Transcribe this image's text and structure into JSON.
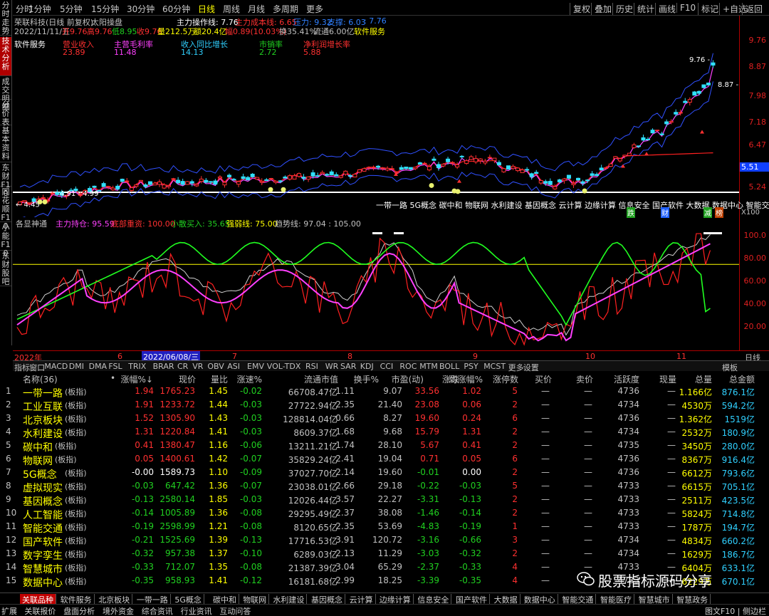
{
  "sidebar": [
    "分时走势",
    "技术分析",
    "成交明细",
    "分价表",
    "基本资料",
    "东财F10",
    "同花顺F10",
    "小能F10",
    "东财股吧"
  ],
  "toolbar": {
    "periods": [
      "分时",
      "1分钟",
      "5分钟",
      "15分钟",
      "30分钟",
      "60分钟",
      "日线",
      "周线",
      "月线",
      "多周期",
      "更多"
    ],
    "selected": "日线",
    "right": [
      "复权",
      "叠加",
      "历史",
      "统计",
      "画线",
      "F10",
      "标记",
      "+自选",
      "返回"
    ]
  },
  "header": {
    "stock": "荣联科技(日线 前复权)",
    "indicator": "太阳操盘",
    "zl_line": "主力操作线: 7.76",
    "zl_cost": "主力成本线: 6.65",
    "ya_li": "压力: 9.32",
    "zhi_cheng": "支撑: 6.03",
    "zhi_cheng2": ": 7.76"
  },
  "quote": {
    "date": "2022/11/11/五",
    "open": "开9.76",
    "high": "高9.76",
    "low": "低8.95",
    "close": "收9.76",
    "volume": "量212.5万",
    "amount": "额20.4亿",
    "change": "幅0.89(10.03%)",
    "turnover": "换35.41%",
    "float": "流通6.00亿",
    "industry": "软件服务"
  },
  "metrics": {
    "name": "软件服务",
    "items": [
      {
        "label": "营业收入",
        "value": "23.89",
        "lc": "#ff3030",
        "vc": "#ff3030"
      },
      {
        "label": "主营毛利率",
        "value": "11.48",
        "lc": "#ff40ff",
        "vc": "#ff40ff"
      },
      {
        "label": "收入同比增长",
        "value": "14.13",
        "lc": "#30d0ff",
        "vc": "#30d0ff"
      },
      {
        "label": "市销率",
        "value": "2.72",
        "lc": "#20d020",
        "vc": "#20d020"
      },
      {
        "label": "净利润增长率",
        "value": "5.88",
        "lc": "#ff3030",
        "vc": "#ff3030"
      }
    ]
  },
  "price_axis": [
    "9.76",
    "8.87",
    "7.98",
    "7.18",
    "6.47",
    "5.84",
    "5.24"
  ],
  "price_current": "5.51",
  "price_labels": {
    "peak": "9.76",
    "peak_right": "8.87",
    "low1": "4.91 - 4.99",
    "low2": "← 4.45"
  },
  "concept_banner": "一带一路 5G概念 碳中和 物联网 水利建设 基因概念 云计算 边缘计算 信息安全 国产软件 大数据 数据中心 智能交",
  "markers": [
    "跌",
    "财",
    "减",
    "榜"
  ],
  "x100": "X100",
  "indicator2": {
    "name": "各显神通",
    "zl": "主力持仓: 95.59",
    "db": "底部重资: 100.00",
    "xs": "小散买入: 35.65",
    "qr": "强弱线: 75.00",
    "qs": "趋势线: 97.04 : 105.00"
  },
  "osc_axis": [
    "100.0",
    "80.00",
    "60.00",
    "40.00",
    "20.00"
  ],
  "date_axis": {
    "year": "2022年",
    "m6": "6",
    "sel": "2022/06/08/三",
    "m7": "7",
    "m8": "8",
    "m9": "9",
    "m10": "10",
    "m11": "11",
    "right": "日线"
  },
  "ind_tabs": [
    "指标",
    "窗口",
    "MACD",
    "DMI",
    "DMA",
    "FSL",
    "TRIX",
    "BRAR",
    "CR",
    "VR",
    "OBV",
    "ASI",
    "EMV",
    "VOL-TDX",
    "RSI",
    "WR",
    "SAR",
    "KDJ",
    "CCI",
    "ROC",
    "MTM",
    "BOLL",
    "PSY",
    "MCST",
    "更多",
    "设置"
  ],
  "ind_tab_right": "模板",
  "table": {
    "headers": [
      "名称(36)",
      "•",
      "涨幅%↓",
      "现价",
      "量比",
      "涨速%",
      "流通市值",
      "换手%",
      "市盈(动)",
      "涨跌",
      "均涨幅%",
      "涨停数",
      "买价",
      "卖价",
      "活跃度",
      "现量",
      "总量",
      "总金额"
    ],
    "rows": [
      [
        "1",
        "一带一路",
        "(板指)",
        "1.94",
        "1765.23",
        "1.45",
        "-0.02",
        "66708.47亿",
        "1.11",
        "9.07",
        "33.56",
        "1.02",
        "5",
        "—",
        "—",
        "4736",
        "—",
        "1.166亿",
        "876.1亿"
      ],
      [
        "2",
        "工业互联",
        "(板指)",
        "1.91",
        "1233.72",
        "1.44",
        "-0.03",
        "27722.94亿",
        "2.35",
        "21.40",
        "23.08",
        "0.06",
        "2",
        "—",
        "—",
        "4734",
        "—",
        "4530万",
        "594.2亿"
      ],
      [
        "3",
        "北京板块",
        "(板指)",
        "1.52",
        "1305.90",
        "1.43",
        "-0.03",
        "128814.04亿",
        "0.66",
        "8.27",
        "19.60",
        "0.24",
        "6",
        "—",
        "—",
        "4736",
        "—",
        "1.362亿",
        "1519亿"
      ],
      [
        "4",
        "水利建设",
        "(板指)",
        "1.31",
        "1220.84",
        "1.41",
        "-0.03",
        "8609.37亿",
        "1.68",
        "9.68",
        "15.79",
        "1.31",
        "2",
        "—",
        "—",
        "4734",
        "—",
        "2532万",
        "180.9亿"
      ],
      [
        "5",
        "碳中和",
        "(板指)",
        "0.41",
        "1380.47",
        "1.16",
        "-0.06",
        "13211.21亿",
        "1.74",
        "28.10",
        "5.67",
        "0.41",
        "2",
        "—",
        "—",
        "4735",
        "—",
        "3450万",
        "280.0亿"
      ],
      [
        "6",
        "物联网",
        "(板指)",
        "0.05",
        "1400.61",
        "1.42",
        "-0.07",
        "35829.24亿",
        "2.41",
        "19.04",
        "0.71",
        "0.05",
        "6",
        "—",
        "—",
        "4736",
        "—",
        "8367万",
        "916.4亿"
      ],
      [
        "7",
        "5G概念",
        "(板指)",
        "-0.00",
        "1589.73",
        "1.10",
        "-0.09",
        "37027.70亿",
        "2.14",
        "19.60",
        "-0.01",
        "0.00",
        "2",
        "—",
        "—",
        "4736",
        "—",
        "6612万",
        "793.6亿"
      ],
      [
        "8",
        "虚拟现实",
        "(板指)",
        "-0.03",
        "647.42",
        "1.36",
        "-0.07",
        "23038.01亿",
        "2.66",
        "29.18",
        "-0.22",
        "-0.03",
        "5",
        "—",
        "—",
        "4733",
        "—",
        "6615万",
        "705.1亿"
      ],
      [
        "9",
        "基因概念",
        "(板指)",
        "-0.13",
        "2580.14",
        "1.85",
        "-0.03",
        "12026.44亿",
        "3.57",
        "22.27",
        "-3.31",
        "-0.13",
        "2",
        "—",
        "—",
        "4733",
        "—",
        "2511万",
        "423.5亿"
      ],
      [
        "10",
        "人工智能",
        "(板指)",
        "-0.14",
        "1005.89",
        "1.36",
        "-0.08",
        "29295.49亿",
        "2.37",
        "38.08",
        "-1.46",
        "-0.14",
        "2",
        "—",
        "—",
        "4733",
        "—",
        "5824万",
        "714.8亿"
      ],
      [
        "11",
        "智能交通",
        "(板指)",
        "-0.19",
        "2598.99",
        "1.21",
        "-0.08",
        "8120.65亿",
        "2.35",
        "53.69",
        "-4.83",
        "-0.19",
        "1",
        "—",
        "—",
        "4733",
        "—",
        "1787万",
        "194.7亿"
      ],
      [
        "12",
        "国产软件",
        "(板指)",
        "-0.21",
        "1525.69",
        "1.39",
        "-0.13",
        "17716.53亿",
        "3.91",
        "120.72",
        "-3.16",
        "-0.66",
        "3",
        "—",
        "—",
        "4734",
        "—",
        "4834万",
        "660.2亿"
      ],
      [
        "13",
        "数字孪生",
        "(板指)",
        "-0.32",
        "957.38",
        "1.37",
        "-0.10",
        "6289.03亿",
        "2.13",
        "11.29",
        "-3.03",
        "-0.32",
        "2",
        "—",
        "—",
        "4734",
        "—",
        "1629万",
        "186.7亿"
      ],
      [
        "14",
        "智慧城市",
        "(板指)",
        "-0.33",
        "712.07",
        "1.35",
        "-0.08",
        "21387.39亿",
        "3.04",
        "65.29",
        "-2.37",
        "-0.33",
        "4",
        "—",
        "—",
        "4733",
        "—",
        "6404万",
        "633.1亿"
      ],
      [
        "15",
        "数据中心",
        "(板指)",
        "-0.35",
        "958.93",
        "1.41",
        "-0.12",
        "16181.68亿",
        "2.99",
        "18.25",
        "-3.39",
        "-0.35",
        "4",
        "—",
        "—",
        "4733",
        "—",
        "6229万",
        "670.1亿"
      ]
    ]
  },
  "bottom_tabs": [
    "关联品种",
    "软件服务",
    "北京板块",
    "一带一路",
    "5G概念",
    "碳中和",
    "物联网",
    "水利建设",
    "基因概念",
    "云计算",
    "边缘计算",
    "信息安全",
    "国产软件",
    "大数据",
    "数据中心",
    "智能交通",
    "智能医疗",
    "智慧城市",
    "智慧政务"
  ],
  "bottom_bar": [
    "扩展",
    "关联报价",
    "盘面分析",
    "境外资金",
    "综合资讯",
    "行业资讯",
    "互动问答"
  ],
  "bottom_right": "图文F10 | 侧边栏",
  "watermark": "股票指标源码分享",
  "colors": {
    "up": "#ff3030",
    "down": "#20d020",
    "neutral": "#ffffff",
    "gold": "#ffff00",
    "accent": "#c00000"
  }
}
